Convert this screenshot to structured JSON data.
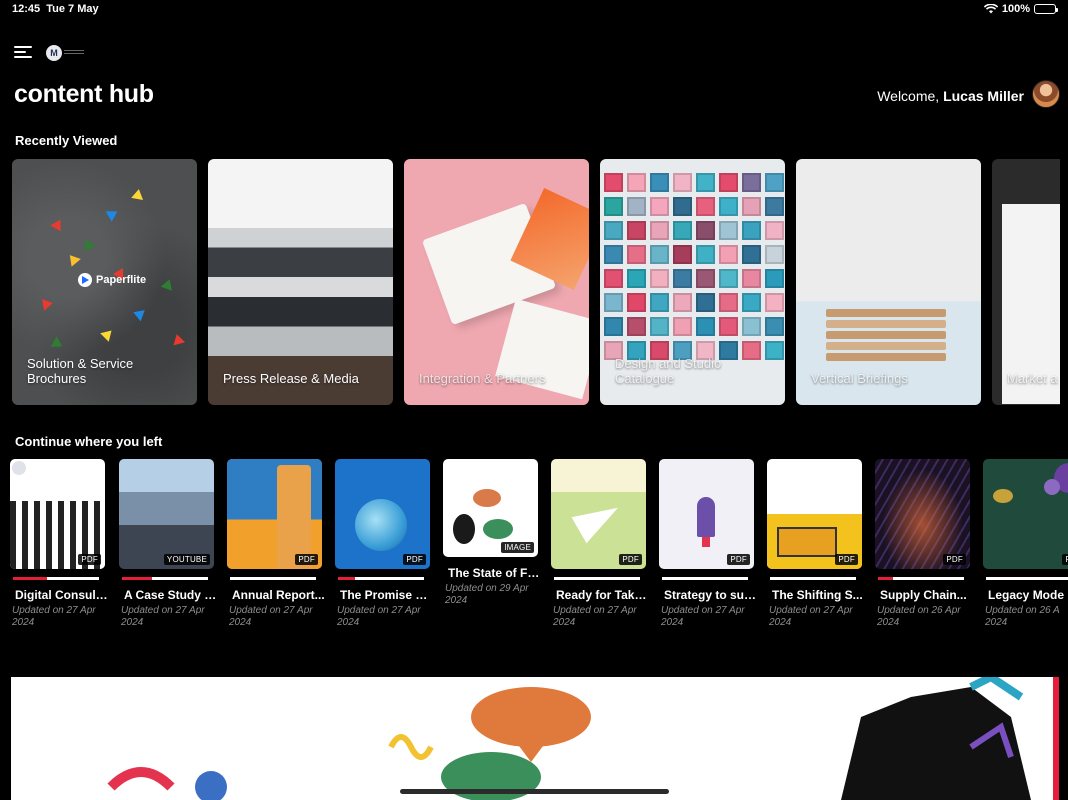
{
  "status_bar": {
    "time": "12:45",
    "date": "Tue 7 May",
    "battery": "100%"
  },
  "header": {
    "logo_letter": "M",
    "title": "content hub",
    "welcome_prefix": "Welcome, ",
    "user_name": "Lucas Miller"
  },
  "sections": {
    "recent": "Recently Viewed",
    "continue": "Continue where you left"
  },
  "recent_cards": [
    {
      "label": "Solution & Service Brochures",
      "brand": "Paperflite"
    },
    {
      "label": "Press Release & Media"
    },
    {
      "label": "Integration & Partners"
    },
    {
      "label": "Design and Studio Catalogue"
    },
    {
      "label": "Vertical Briefings"
    },
    {
      "label": "Market a"
    }
  ],
  "continue_items": [
    {
      "title": "Digital Consult...",
      "type": "PDF",
      "date": "Updated on 27 Apr 2024",
      "progress": 0.4
    },
    {
      "title": "A Case Study o...",
      "type": "YOUTUBE",
      "date": "Updated on 27 Apr 2024",
      "progress": 0.35
    },
    {
      "title": "Annual Report...",
      "type": "PDF",
      "date": "Updated on 27 Apr 2024",
      "progress": 0
    },
    {
      "title": "The Promise of...",
      "type": "PDF",
      "date": "Updated on 27 Apr 2024",
      "progress": 0.2
    },
    {
      "title": "The State of Fa...",
      "type": "IMAGE",
      "date": "Updated on 29 Apr 2024",
      "progress": 0
    },
    {
      "title": "Ready for Take...",
      "type": "PDF",
      "date": "Updated on 27 Apr 2024",
      "progress": 0
    },
    {
      "title": "Strategy to sus...",
      "type": "PDF",
      "date": "Updated on 27 Apr 2024",
      "progress": 0
    },
    {
      "title": "The Shifting S...",
      "type": "PDF",
      "date": "Updated on 27 Apr 2024",
      "progress": 0
    },
    {
      "title": "Supply Chain...",
      "type": "PDF",
      "date": "Updated on 26 Apr 2024",
      "progress": 0.18
    },
    {
      "title": "Legacy Mode",
      "type": "P",
      "date": "Updated on 26 A 2024",
      "progress": 0
    }
  ],
  "colors": {
    "accent": "#e41f3c",
    "background": "#000000"
  }
}
